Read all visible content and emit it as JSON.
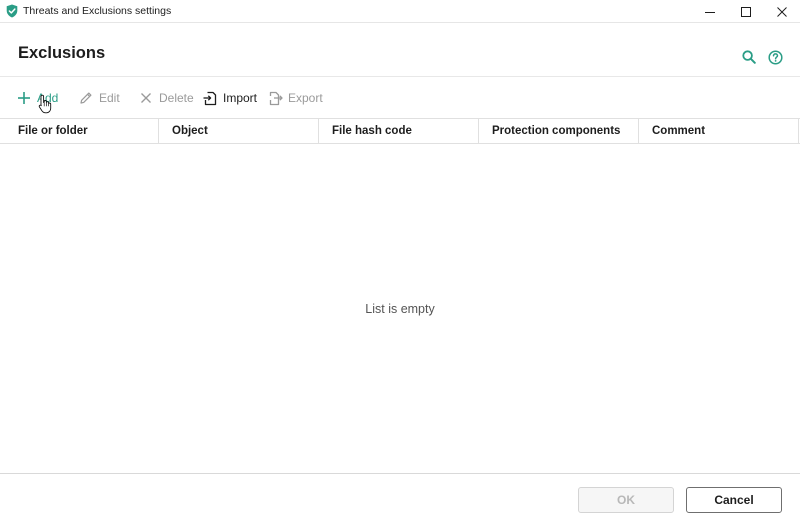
{
  "window": {
    "title": "Threats and Exclusions settings"
  },
  "header": {
    "title": "Exclusions",
    "icons": [
      "search-icon",
      "help-icon"
    ]
  },
  "toolbar": {
    "add_label": "Add",
    "edit_label": "Edit",
    "delete_label": "Delete",
    "import_label": "Import",
    "export_label": "Export"
  },
  "table": {
    "columns": [
      "File or folder",
      "Object",
      "File hash code",
      "Protection components",
      "Comment"
    ],
    "rows": [],
    "empty_text": "List is empty"
  },
  "footer": {
    "ok_label": "OK",
    "cancel_label": "Cancel"
  },
  "colors": {
    "accent": "#2a9d86",
    "text": "#1d1d1d",
    "disabled": "#9a9a9a"
  }
}
